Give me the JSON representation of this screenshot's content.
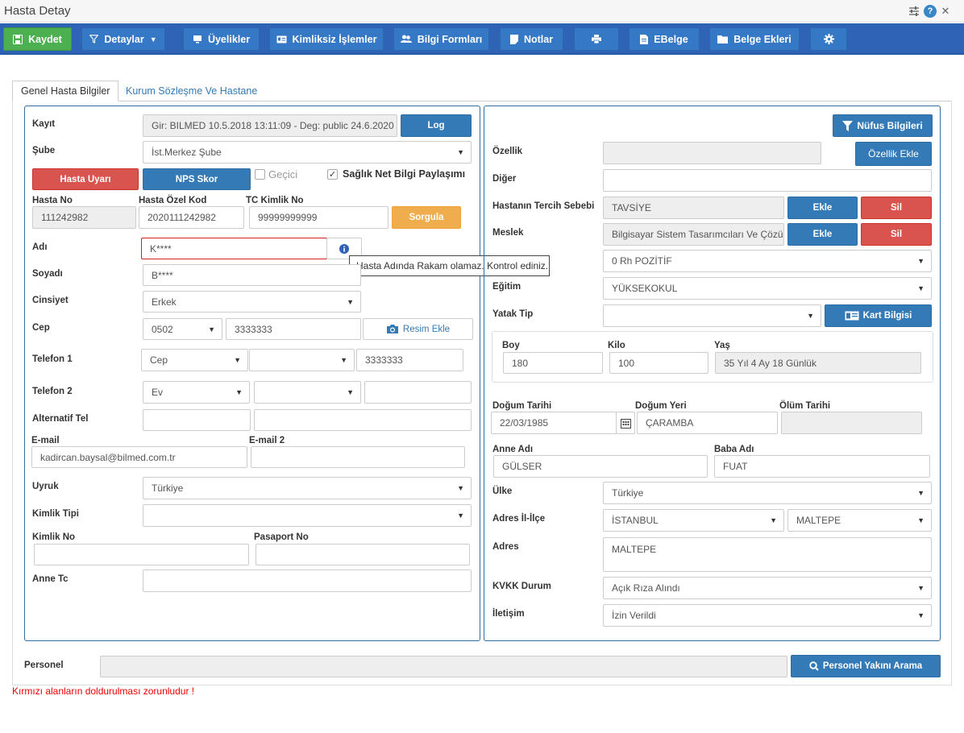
{
  "window": {
    "title": "Hasta Detay",
    "icons": [
      "sliders-icon",
      "help-icon",
      "close-icon"
    ],
    "help_glyph": "?",
    "close_glyph": "✕",
    "sliders_glyph": "☰"
  },
  "toolbar": {
    "save": "Kaydet",
    "details": "Detaylar",
    "memberships": "Üyelikler",
    "anonymous": "Kimliksiz İşlemler",
    "info_forms": "Bilgi Formları",
    "notes": "Notlar",
    "ebelge": "EBelge",
    "doc_attachments": "Belge Ekleri"
  },
  "tabs": {
    "general": "Genel Hasta Bilgiler",
    "institution": "Kurum Sözleşme Ve Hastane"
  },
  "left": {
    "kayit_label": "Kayıt",
    "kayit_value": "Gir: BILMED  10.5.2018 13:11:09 - Deg: public  24.6.2020 17",
    "log_button": "Log",
    "sube_label": "Şube",
    "sube_value": "İst.Merkez Şube",
    "hasta_uyari": "Hasta Uyarı",
    "nps_skor": "NPS Skor",
    "gecici": "Geçici",
    "saglik_net": "Sağlık Net Bilgi Paylaşımı",
    "hasta_no_label": "Hasta No",
    "hasta_no": "111242982",
    "ozel_kod_label": "Hasta Özel Kod",
    "ozel_kod": "2020111242982",
    "tc_label": "TC Kimlik No",
    "tc": "99999999999",
    "sorgula": "Sorgula",
    "adi_label": "Adı",
    "adi": "K****",
    "tooltip": "Hasta Adında Rakam olamaz. Kontrol ediniz.",
    "soyadi_label": "Soyadı",
    "soyadi": "B****",
    "cinsiyet_label": "Cinsiyet",
    "cinsiyet": "Erkek",
    "cep_label": "Cep",
    "cep_code": "0502",
    "cep_number": "3333333",
    "resim_ekle": "Resim Ekle",
    "tel1_label": "Telefon 1",
    "tel1_type": "Cep",
    "tel1_number": "3333333",
    "tel2_label": "Telefon 2",
    "tel2_type": "Ev",
    "alt_tel_label": "Alternatif Tel",
    "email_label": "E-mail",
    "email": "kadircan.baysal@bilmed.com.tr",
    "email2_label": "E-mail 2",
    "uyruk_label": "Uyruk",
    "uyruk": "Türkiye",
    "kimlik_tipi_label": "Kimlik Tipi",
    "kimlik_no_label": "Kimlik No",
    "pasaport_label": "Pasaport No",
    "anne_tc_label": "Anne Tc"
  },
  "right": {
    "nufus_bilgileri": "Nüfus Bilgileri",
    "ozellik_label": "Özellik",
    "ozellik_ekle": "Özellik Ekle",
    "diger_label": "Diğer",
    "tercih_label": "Hastanın Tercih Sebebi",
    "tercih_value": "TAVSİYE",
    "ekle": "Ekle",
    "sil": "Sil",
    "meslek_label": "Meslek",
    "meslek_value": "Bilgisayar Sistem Tasarımcıları Ve Çözümleyicileri",
    "kan_value": "0 Rh POZİTİF",
    "egitim_label": "Eğitim",
    "egitim_value": "YÜKSEKOKUL",
    "yatak_label": "Yatak Tip",
    "kart_bilgisi": "Kart Bilgisi",
    "boy_label": "Boy",
    "boy": "180",
    "kilo_label": "Kilo",
    "kilo": "100",
    "yas_label": "Yaş",
    "yas": "35 Yıl  4 Ay  18 Günlük",
    "dogum_tarihi_label": "Doğum Tarihi",
    "dogum_tarihi": "22/03/1985",
    "dogum_yeri_label": "Doğum Yeri",
    "dogum_yeri": "ÇARAMBA",
    "olum_label": "Ölüm Tarihi",
    "anne_label": "Anne Adı",
    "anne": "GÜLSER",
    "baba_label": "Baba Adı",
    "baba": "FUAT",
    "ulke_label": "Ülke",
    "ulke": "Türkiye",
    "adres_ilce_label": "Adres İl-İlçe",
    "il": "İSTANBUL",
    "ilce": "MALTEPE",
    "adres_label": "Adres",
    "adres": "MALTEPE",
    "kvkk_label": "KVKK Durum",
    "kvkk": "Açık Rıza Alındı",
    "iletisim_label": "İletişim",
    "iletisim": "İzin Verildi"
  },
  "footer": {
    "personel_label": "Personel",
    "personel_search": "Personel Yakını Arama",
    "required_note": "Kırmızı alanların doldurulması zorunludur !"
  },
  "colors": {
    "toolbar": "#2e63b6",
    "primary": "#337ab7",
    "danger": "#d9534f",
    "warning": "#f0ad4e",
    "success": "#4caf50"
  }
}
